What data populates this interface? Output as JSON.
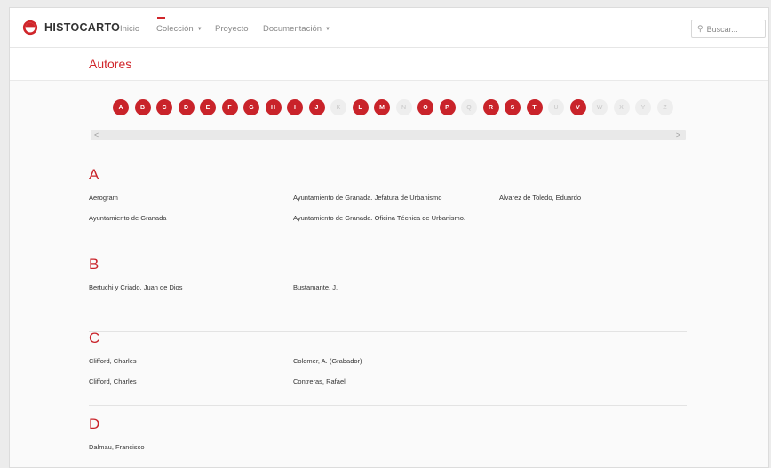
{
  "brand": {
    "name": "HISTOCARTO",
    "color": "#d0262b"
  },
  "nav": {
    "items": [
      {
        "label": "Inicio",
        "dropdown": false
      },
      {
        "label": "Colección",
        "dropdown": true,
        "active": true
      },
      {
        "label": "Proyecto",
        "dropdown": false
      },
      {
        "label": "Documentación",
        "dropdown": true
      }
    ],
    "caret": "▼"
  },
  "search": {
    "placeholder": "Buscar...",
    "icon": "search-icon"
  },
  "page": {
    "title": "Autores"
  },
  "alphabet": [
    {
      "l": "A",
      "on": true
    },
    {
      "l": "B",
      "on": true
    },
    {
      "l": "C",
      "on": true
    },
    {
      "l": "D",
      "on": true
    },
    {
      "l": "E",
      "on": true
    },
    {
      "l": "F",
      "on": true
    },
    {
      "l": "G",
      "on": true
    },
    {
      "l": "H",
      "on": true
    },
    {
      "l": "I",
      "on": true
    },
    {
      "l": "J",
      "on": true
    },
    {
      "l": "K",
      "on": false
    },
    {
      "l": "L",
      "on": true
    },
    {
      "l": "M",
      "on": true
    },
    {
      "l": "N",
      "on": false
    },
    {
      "l": "O",
      "on": true
    },
    {
      "l": "P",
      "on": true
    },
    {
      "l": "Q",
      "on": false
    },
    {
      "l": "R",
      "on": true
    },
    {
      "l": "S",
      "on": true
    },
    {
      "l": "T",
      "on": true
    },
    {
      "l": "U",
      "on": false
    },
    {
      "l": "V",
      "on": true
    },
    {
      "l": "W",
      "on": false
    },
    {
      "l": "X",
      "on": false
    },
    {
      "l": "Y",
      "on": false
    },
    {
      "l": "Z",
      "on": false
    }
  ],
  "scroll_arrows": {
    "left": "<",
    "right": ">"
  },
  "sections": [
    {
      "letter": "A",
      "columns": [
        [
          "Aerogram",
          "Ayuntamiento de Granada"
        ],
        [
          "Ayuntamiento de Granada. Jefatura de Urbanismo",
          "Ayuntamiento de Granada. Oficina Técnica de Urbanismo."
        ],
        [
          "Alvarez de Toledo, Eduardo"
        ]
      ]
    },
    {
      "letter": "B",
      "columns": [
        [
          "Bertuchi y Criado, Juan de Dios"
        ],
        [
          "Bustamante, J."
        ]
      ]
    },
    {
      "letter": "C",
      "columns": [
        [
          "Clifford, Charles",
          "Clifford, Charles"
        ],
        [
          "Colomer, A. (Grabador)",
          "Contreras, Rafael"
        ]
      ]
    },
    {
      "letter": "D",
      "columns": [
        [
          "Dalmau, Francisco"
        ]
      ]
    }
  ]
}
